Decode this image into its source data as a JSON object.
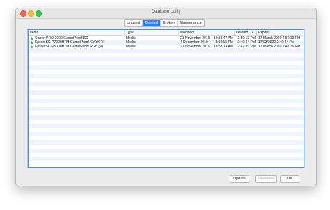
{
  "window": {
    "title": "Database Utility"
  },
  "tabs": [
    {
      "label": "Unused",
      "active": false
    },
    {
      "label": "Deleted",
      "active": true
    },
    {
      "label": "Broken",
      "active": false
    },
    {
      "label": "Maintenance",
      "active": false
    }
  ],
  "table": {
    "columns": [
      "Items",
      "Type",
      "Modified",
      "Deleted",
      "Expires"
    ],
    "sort_column": "Deleted",
    "rows": [
      {
        "item": "Canon PRO-2000 GamutProof190",
        "type": "Media",
        "modified_date": "21 November 2019",
        "modified_time": "10:58:47 AM",
        "deleted": "2:50:13 PM",
        "expires": "17 March 2020 2:50:13 PM"
      },
      {
        "item": "Epson SC-P7000HTM GamutProof CMYK-V",
        "type": "Media",
        "modified_date": "4 December 2019",
        "modified_time": "1:04:15 PM",
        "deleted": "2:49:44 PM",
        "expires": "17/03/2020 2:49:44 PM"
      },
      {
        "item": "Epson SC-P5000HTM GamutProof RGB (V)",
        "type": "Media",
        "modified_date": "21 November 2019",
        "modified_time": "10:58:14 AM",
        "deleted": "2:47:39 PM",
        "expires": "17 March 2020 2:47:39 PM"
      }
    ]
  },
  "buttons": {
    "update": "Update",
    "undelete": "Undelete",
    "ok": "OK"
  },
  "colors": {
    "accent": "#2e7cf6",
    "stripe": "#eef4fd",
    "item_icon": "#3da83d"
  }
}
